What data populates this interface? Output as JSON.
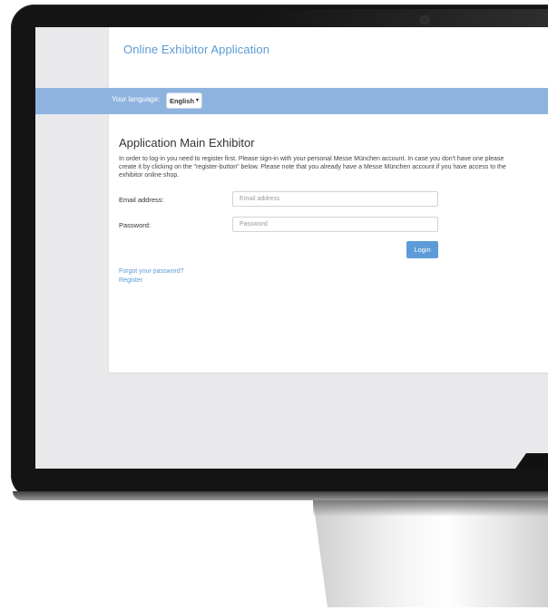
{
  "app": {
    "title": "Online Exhibitor Application"
  },
  "language": {
    "label": "Your language:",
    "selected": "English"
  },
  "main": {
    "heading": "Application Main Exhibitor",
    "intro": "In order to log-in you need to register first. Please sign-in with your personal Messe München account. In case you don't have one please create it by clicking on the \"register-button\" below. Please note that you already have a Messe München account if you have access to the exhibitor online shop."
  },
  "form": {
    "email_label": "Email address:",
    "email_placeholder": "Email address",
    "password_label": "Password:",
    "password_placeholder": "Password",
    "login_label": "Login"
  },
  "links": {
    "forgot_password": "Forgot your password?",
    "register": "Register"
  },
  "colors": {
    "accent": "#5b9bd5",
    "language_bar": "#8fb3df",
    "login_button": "#5c9bd8"
  }
}
